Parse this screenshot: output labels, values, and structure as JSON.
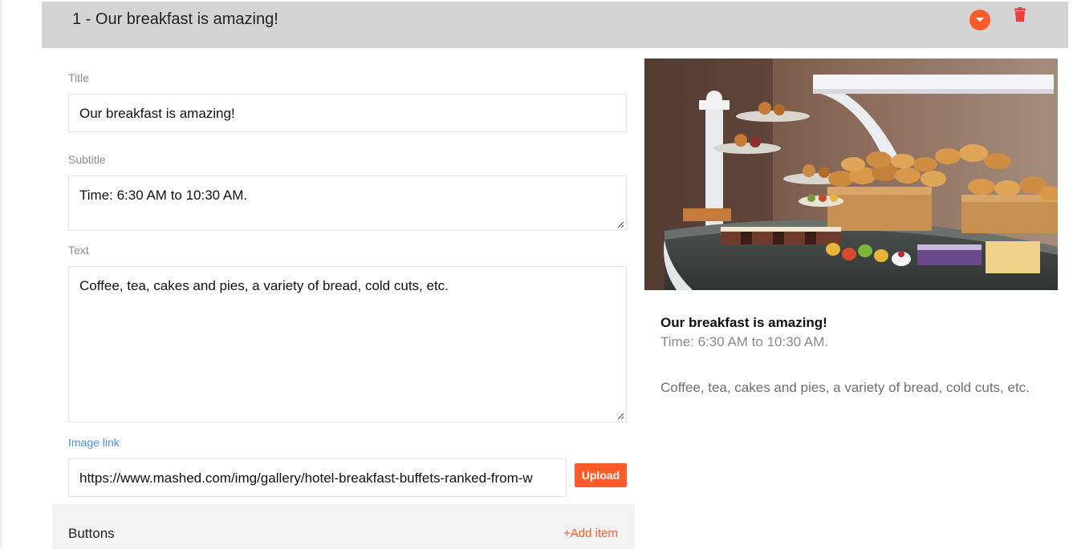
{
  "header": {
    "title": "1 - Our breakfast is amazing!",
    "collapse_icon": "chevron-down-icon",
    "delete_icon": "trash-icon"
  },
  "form": {
    "title_label": "Title",
    "title_value": "Our breakfast is amazing!",
    "subtitle_label": "Subtitle",
    "subtitle_value": "Time: 6:30 AM to 10:30 AM.",
    "text_label": "Text",
    "text_value": "Coffee, tea, cakes and pies, a variety of bread, cold cuts, etc.",
    "image_label": "Image link",
    "image_value": "https://www.mashed.com/img/gallery/hotel-breakfast-buffets-ranked-from-w",
    "upload_label": "Upload"
  },
  "buttons_section": {
    "label": "Buttons",
    "add_label": "+Add item"
  },
  "preview": {
    "title": "Our breakfast is amazing!",
    "subtitle": "Time: 6:30 AM to 10:30 AM.",
    "text": "Coffee, tea, cakes and pies, a variety of bread, cold cuts, etc."
  },
  "colors": {
    "accent": "#ff5a2a",
    "header_bg": "#d4d4d4",
    "delete": "#e8403a",
    "link_label": "#4b8ee6"
  }
}
